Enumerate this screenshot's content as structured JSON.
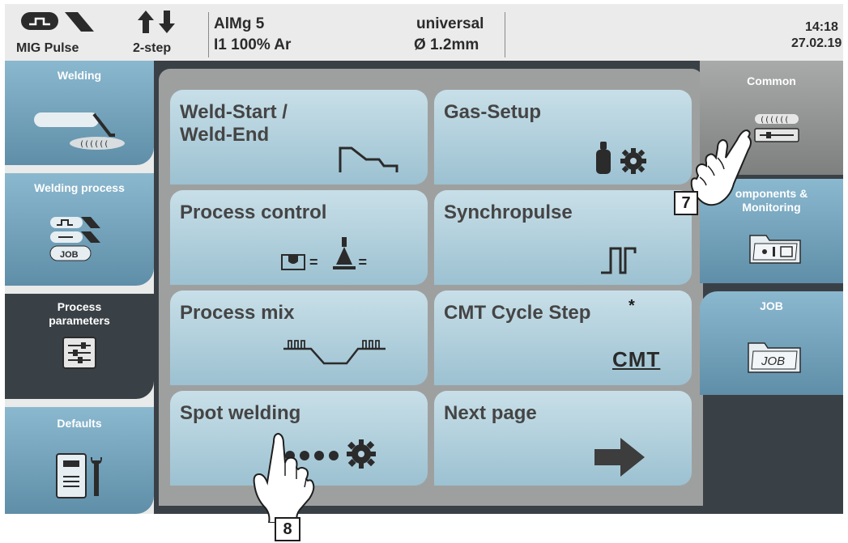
{
  "header": {
    "mode": "MIG Pulse",
    "trigger": "2-step",
    "material": "AlMg 5",
    "gas": "I1 100% Ar",
    "characteristic": "universal",
    "wire": "Ø  1.2mm",
    "time": "14:18",
    "date": "27.02.19"
  },
  "left_nav": [
    {
      "label": "Welding"
    },
    {
      "label": "Welding process"
    },
    {
      "label": "Process\nparameters"
    },
    {
      "label": "Defaults"
    }
  ],
  "welding_process_icon_text": "JOB",
  "tiles": [
    {
      "label": "Weld-Start /\nWeld-End"
    },
    {
      "label": "Gas-Setup"
    },
    {
      "label": "Process control"
    },
    {
      "label": "Synchropulse"
    },
    {
      "label": "Process mix"
    },
    {
      "label": "CMT Cycle Step"
    },
    {
      "label": "Spot welding"
    },
    {
      "label": "Next page"
    }
  ],
  "process_control_eq": "=",
  "cmt_asterisk": "*",
  "cmt_icon_text": "CMT",
  "right_nav": [
    {
      "label": "Common"
    },
    {
      "label": "omponents &\nMonitoring"
    },
    {
      "label": "JOB"
    }
  ],
  "job_folder_text": "JOB",
  "callouts": {
    "seven": "7",
    "eight": "8"
  },
  "colors": {
    "tile_top": "#c8dfe8",
    "tile_bottom": "#9cc1d1",
    "nav_blue": "#5f8ea8",
    "active_dark": "#3a4146",
    "common_gray": "#8e8f8f"
  }
}
